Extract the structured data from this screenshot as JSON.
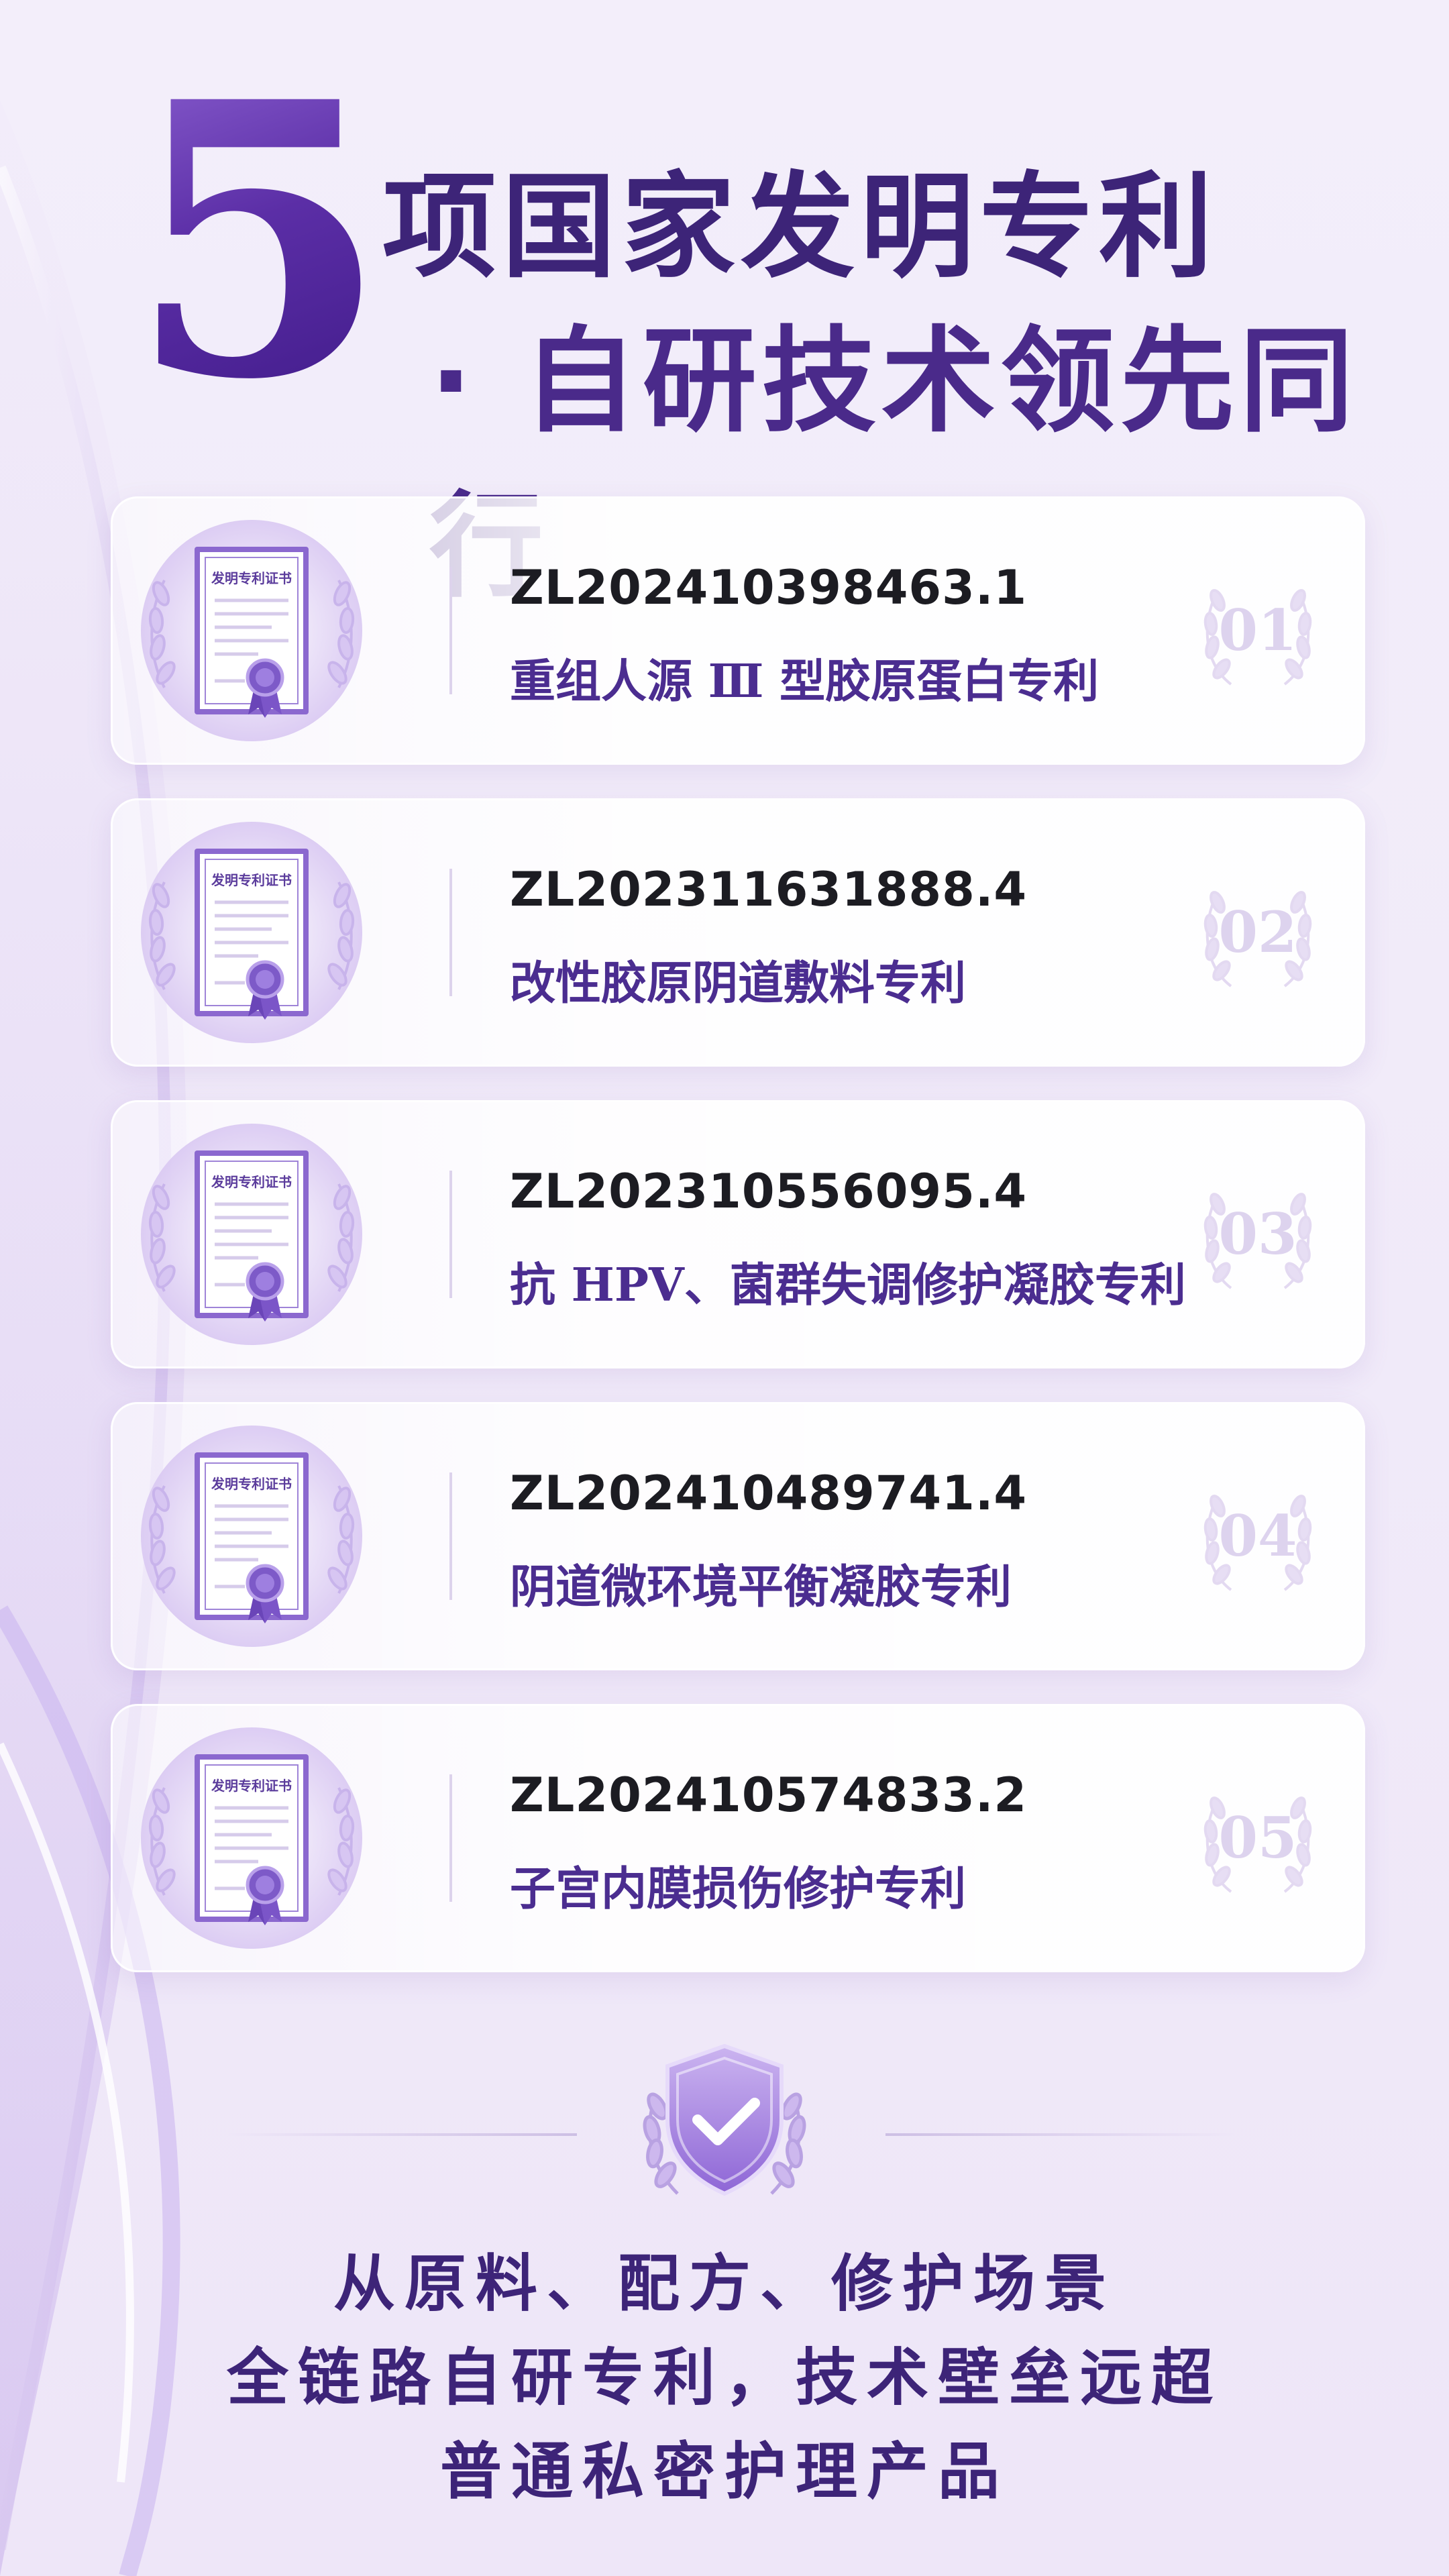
{
  "headline": {
    "number": "5",
    "line1": "项国家发明专利",
    "line2": "· 自研技术领先同行"
  },
  "certificate": {
    "label": "发明专利证书"
  },
  "patents": [
    {
      "number": "ZL202410398463.1",
      "name": "重组人源 Ⅲ 型胶原蛋白专利",
      "index": "01"
    },
    {
      "number": "ZL202311631888.4",
      "name": "改性胶原阴道敷料专利",
      "index": "02"
    },
    {
      "number": "ZL202310556095.4",
      "name": "抗 HPV、菌群失调修护凝胶专利",
      "index": "03"
    },
    {
      "number": "ZL202410489741.4",
      "name": "阴道微环境平衡凝胶专利",
      "index": "04"
    },
    {
      "number": "ZL202410574833.2",
      "name": "子宫内膜损伤修护专利",
      "index": "05"
    }
  ],
  "slogan": {
    "line1": "从原料、配方、修护场景",
    "line2": "全链路自研专利，技术壁垒远超",
    "line3": "普通私密护理产品"
  },
  "colors": {
    "primary": "#4b2d90",
    "accent": "#5b2ea6",
    "background": "#f3eefa"
  }
}
